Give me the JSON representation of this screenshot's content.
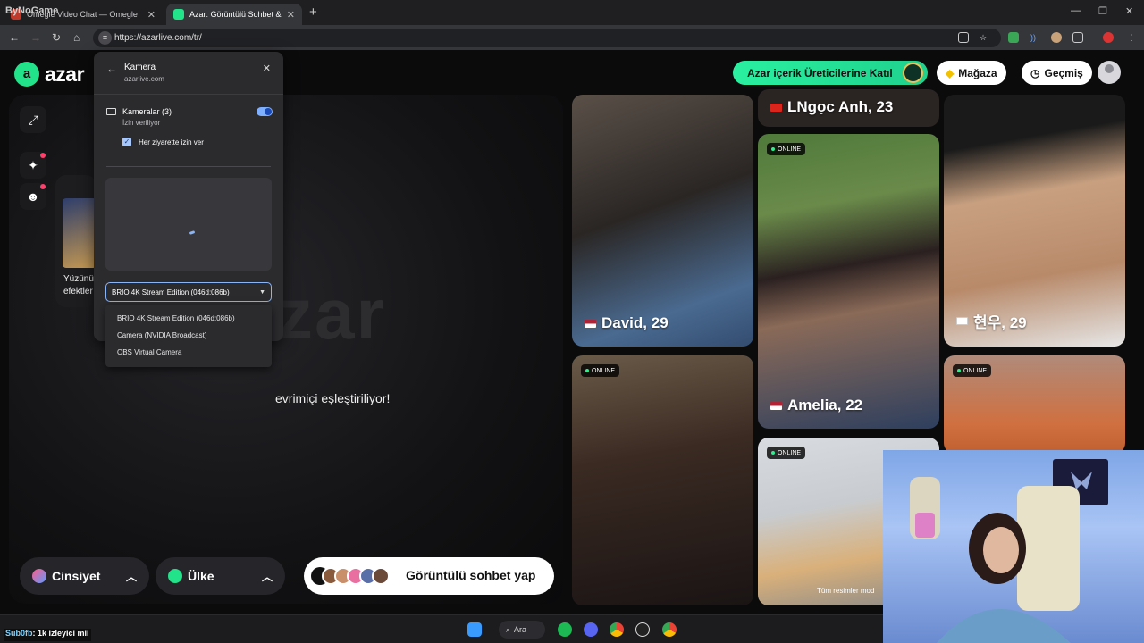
{
  "browser": {
    "brand_overlay": "ByNoGame",
    "tabs": [
      {
        "title": "Omegle Video Chat — Omegle",
        "active": false,
        "favicon_color": "#c0392b"
      },
      {
        "title": "Azar: Görüntülü Sohbet & Yeni",
        "active": true,
        "favicon_color": "#22e28a"
      }
    ],
    "url": "https://azarlive.com/tr/"
  },
  "header": {
    "logo_text": "azar",
    "creator_button": "Azar içerik Üreticilerine Katıl",
    "shop_button": "Mağaza",
    "history_button": "Geçmiş"
  },
  "stage": {
    "watermark": "zar",
    "status": "evrimiçi eşleştiriliyor!",
    "promo_label_1": "Yüzünü",
    "promo_label_2": "efektler"
  },
  "bottom": {
    "gender_label": "Cinsiyet",
    "country_label": "Ülke",
    "cta_label": "Görüntülü sohbet yap"
  },
  "cards": [
    {
      "name": "David, 29",
      "flag": "us",
      "online": false
    },
    {
      "name": "LNgọc Anh, 23",
      "flag": "vn",
      "online": false
    },
    {
      "name": "현우, 29",
      "flag": "kr",
      "online": false
    },
    {
      "name": "Amelia, 22",
      "flag": "us",
      "online": true
    },
    {
      "name": "",
      "online": true
    },
    {
      "name": "",
      "online": true
    },
    {
      "name": "",
      "online": true
    }
  ],
  "online_label": "ONLINE",
  "photo_caption": "Tüm resimler mod",
  "popup": {
    "title": "Kamera",
    "site": "azarlive.com",
    "permission_title": "Kameralar (3)",
    "permission_sub": "İzin veriliyor",
    "checkbox_label": "Her ziyarette izin ver",
    "selected_camera": "BRIO 4K Stream Edition (046d:086b)",
    "options": [
      "BRIO 4K Stream Edition (046d:086b)",
      "Camera (NVIDIA Broadcast)",
      "OBS Virtual Camera"
    ]
  },
  "taskbar": {
    "search_label": "Ara"
  },
  "stream_chat": {
    "user": "Sub0fb",
    "message": ": 1k izleyici mii"
  }
}
